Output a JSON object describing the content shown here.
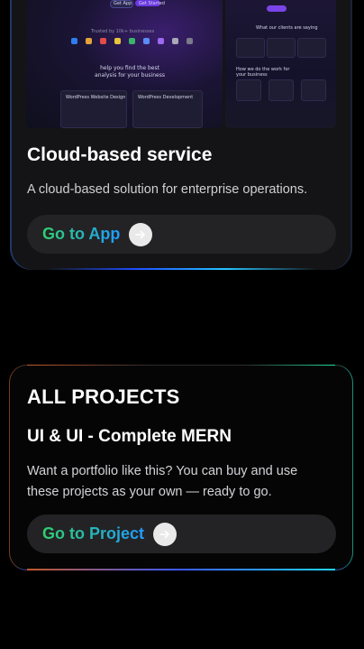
{
  "card_cloud": {
    "title": "Cloud-based service",
    "description": "A cloud-based solution for enterprise operations.",
    "button_label": "Go to App",
    "button_icon": "arrow-right-icon",
    "preview": {
      "main_heading": "help you find the best analysis for your business",
      "nav_a": "Get App",
      "nav_b": "Get Started",
      "logos_caption": "Trusted by 10k+ businesses",
      "box_left": "WordPress Website Design",
      "box_right": "WordPress Development",
      "side_heading": "What our clients are saying",
      "side_section": "How we do the work for your business"
    }
  },
  "card_projects": {
    "heading": "ALL PROJECTS",
    "subheading": "UI & UI - Complete MERN",
    "description": "Want a portfolio like this? You can buy and use these projects as your own — ready to go.",
    "button_label": "Go to Project",
    "button_icon": "arrow-right-icon"
  },
  "colors": {
    "button_gradient_start": "#2fd16b",
    "button_gradient_end": "#1f9bff",
    "card_bg": "#141416",
    "button_bg": "#232326"
  }
}
